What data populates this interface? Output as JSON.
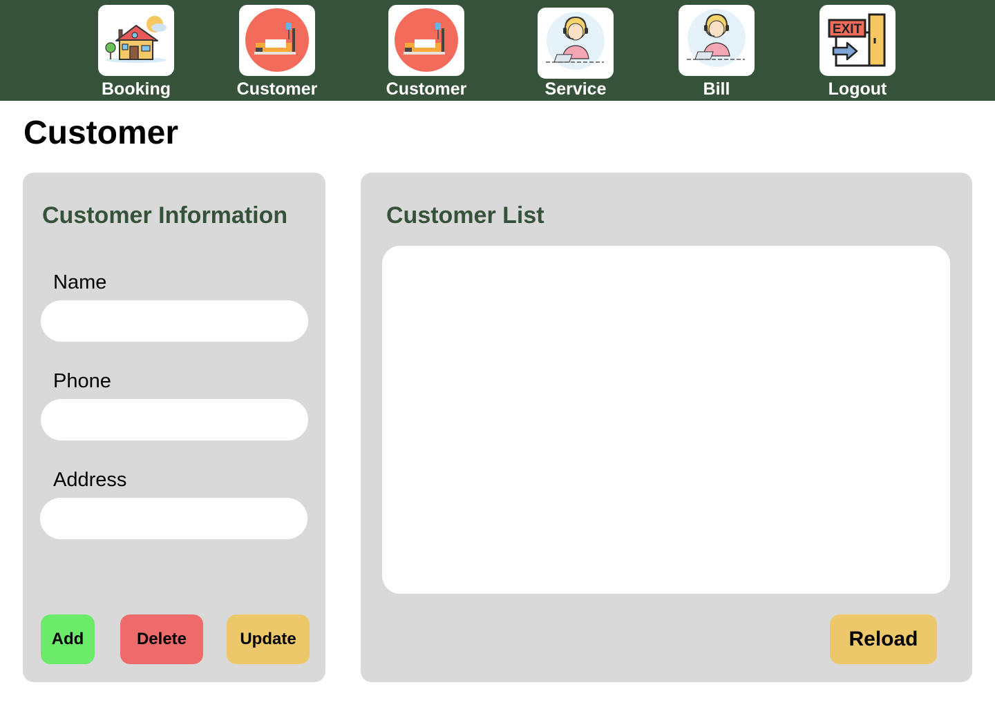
{
  "nav": {
    "items": [
      {
        "label": "Booking",
        "icon": "house-icon"
      },
      {
        "label": "Customer",
        "icon": "bed-icon"
      },
      {
        "label": "Customer",
        "icon": "bed-icon"
      },
      {
        "label": "Service",
        "icon": "support-agent-icon"
      },
      {
        "label": "Bill",
        "icon": "support-agent-icon"
      },
      {
        "label": "Logout",
        "icon": "exit-door-icon"
      }
    ],
    "exit_sign_text": "EXIT"
  },
  "page": {
    "title": "Customer"
  },
  "customer_form": {
    "title": "Customer Information",
    "fields": [
      {
        "label": "Name",
        "value": ""
      },
      {
        "label": "Phone",
        "value": ""
      },
      {
        "label": "Address",
        "value": ""
      }
    ],
    "buttons": {
      "add": "Add",
      "delete": "Delete",
      "update": "Update"
    }
  },
  "customer_list": {
    "title": "Customer List",
    "reload_label": "Reload"
  },
  "colors": {
    "topbar": "#36523a",
    "accent_text": "#36523a",
    "panel": "#d9d9d9",
    "add": "#6ceb6b",
    "delete": "#ee6b6b",
    "update": "#ecc86b",
    "reload": "#ecc86b",
    "bed_circle": "#f26b5b"
  }
}
